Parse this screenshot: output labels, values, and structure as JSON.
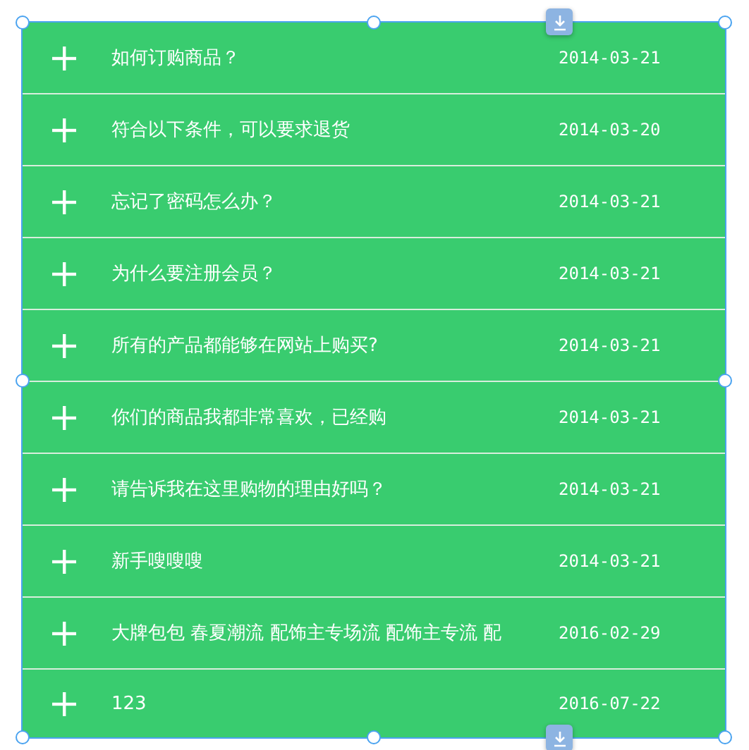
{
  "faq_items": [
    {
      "title": "如何订购商品？",
      "date": "2014-03-21"
    },
    {
      "title": "符合以下条件，可以要求退货",
      "date": "2014-03-20"
    },
    {
      "title": "忘记了密码怎么办？",
      "date": "2014-03-21"
    },
    {
      "title": "为什么要注册会员？",
      "date": "2014-03-21"
    },
    {
      "title": "所有的产品都能够在网站上购买?",
      "date": "2014-03-21"
    },
    {
      "title": "你们的商品我都非常喜欢，已经购",
      "date": "2014-03-21"
    },
    {
      "title": "请告诉我在这里购物的理由好吗？",
      "date": "2014-03-21"
    },
    {
      "title": "新手嗖嗖嗖",
      "date": "2014-03-21"
    },
    {
      "title": "大牌包包 春夏潮流 配饰主专场流 配饰主专流 配",
      "date": "2016-02-29"
    },
    {
      "title": "123",
      "date": "2016-07-22"
    }
  ]
}
